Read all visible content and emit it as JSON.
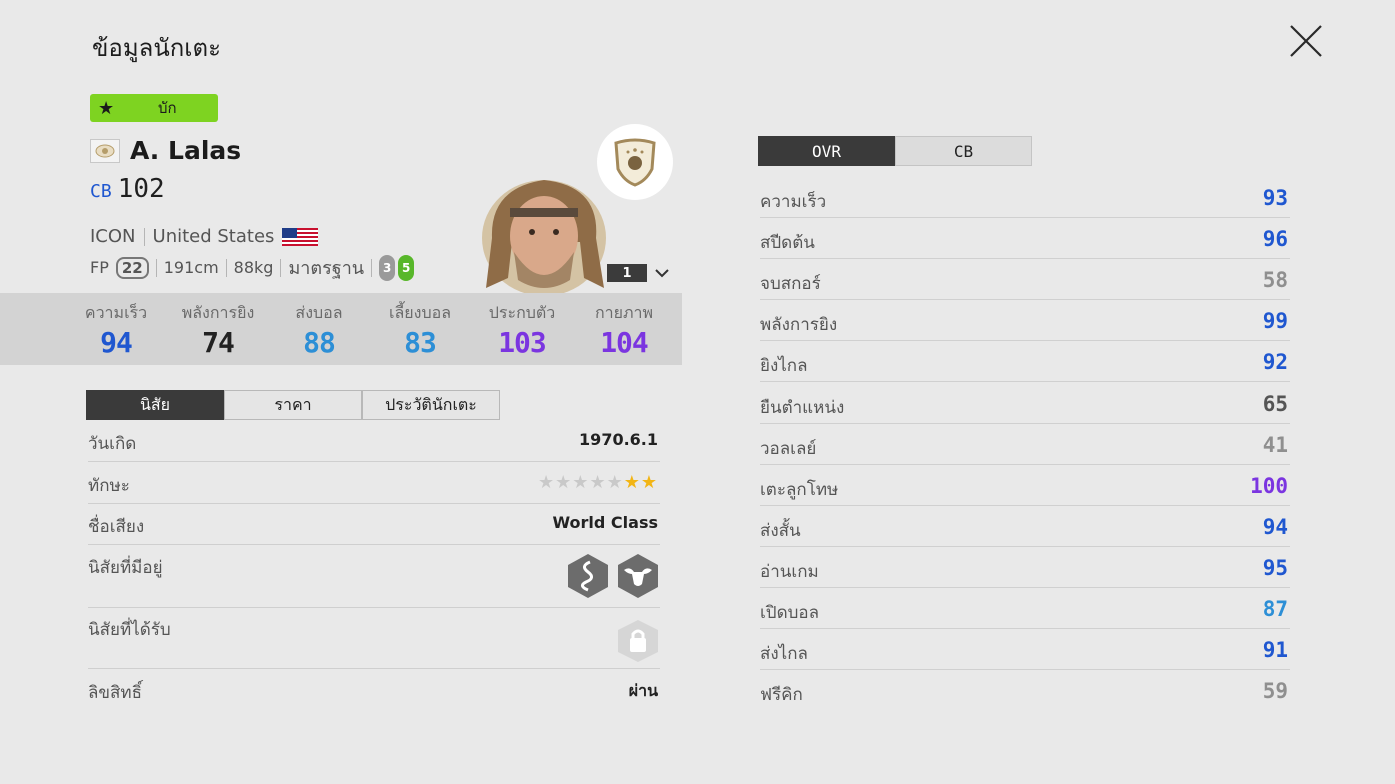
{
  "header": {
    "title": "ข้อมูลนักเตะ"
  },
  "player": {
    "bonus_label": "บัก",
    "name": "A. Lalas",
    "position": "CB",
    "ovr": "102",
    "category": "ICON",
    "nation": "United States",
    "fp_label": "FP",
    "fp_value": "22",
    "height": "191cm",
    "weight": "88kg",
    "body_type": "มาตรฐาน",
    "weak_foot": "3",
    "strong_foot": "5",
    "level": "1"
  },
  "summary_stats": [
    {
      "label": "ความเร็ว",
      "value": "94",
      "color": "#1f57d0"
    },
    {
      "label": "พลังการยิง",
      "value": "74",
      "color": "#222222"
    },
    {
      "label": "ส่งบอล",
      "value": "88",
      "color": "#2d8fd6"
    },
    {
      "label": "เลี้ยงบอล",
      "value": "83",
      "color": "#2d8fd6"
    },
    {
      "label": "ประกบตัว",
      "value": "103",
      "color": "#7b35e0"
    },
    {
      "label": "กายภาพ",
      "value": "104",
      "color": "#7b35e0"
    }
  ],
  "info_tabs": [
    "นิสัย",
    "ราคา",
    "ประวัตินักเตะ"
  ],
  "info_active_tab": 0,
  "info": {
    "birth_label": "วันเกิด",
    "birth_value": "1970.6.1",
    "skill_label": "ทักษะ",
    "skill_stars": 2,
    "skill_max": 7,
    "reputation_label": "ชื่อเสียง",
    "reputation_value": "World Class",
    "traits_label": "นิสัยที่มีอยู่",
    "traits_icons": [
      "snake-trait-icon",
      "buffalo-trait-icon"
    ],
    "acquired_label": "นิสัยที่ได้รับ",
    "acquired_icon": "lock-icon",
    "license_label": "ลิขสิทธิ์",
    "license_value": "ผ่าน"
  },
  "attr_tabs": [
    "OVR",
    "CB"
  ],
  "attr_active_tab": 0,
  "attributes": [
    {
      "name": "ความเร็ว",
      "value": "93",
      "color": "#1f57d0"
    },
    {
      "name": "สปีดต้น",
      "value": "96",
      "color": "#1f57d0"
    },
    {
      "name": "จบสกอร์",
      "value": "58",
      "color": "#8f8f8f"
    },
    {
      "name": "พลังการยิง",
      "value": "99",
      "color": "#1f57d0"
    },
    {
      "name": "ยิงไกล",
      "value": "92",
      "color": "#1f57d0"
    },
    {
      "name": "ยืนตำแหน่ง",
      "value": "65",
      "color": "#555555"
    },
    {
      "name": "วอลเลย์",
      "value": "41",
      "color": "#8f8f8f"
    },
    {
      "name": "เตะลูกโทษ",
      "value": "100",
      "color": "#7b35e0"
    },
    {
      "name": "ส่งสั้น",
      "value": "94",
      "color": "#1f57d0"
    },
    {
      "name": "อ่านเกม",
      "value": "95",
      "color": "#1f57d0"
    },
    {
      "name": "เปิดบอล",
      "value": "87",
      "color": "#2d8fd6"
    },
    {
      "name": "ส่งไกล",
      "value": "91",
      "color": "#1f57d0"
    },
    {
      "name": "ฟรีคิก",
      "value": "59",
      "color": "#8f8f8f"
    }
  ]
}
